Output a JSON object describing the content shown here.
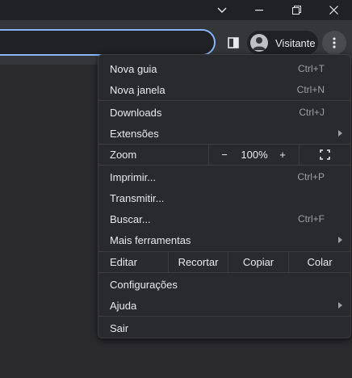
{
  "window": {
    "controls": [
      "chevron-down-icon",
      "minimize-icon",
      "restore-icon",
      "close-icon"
    ]
  },
  "toolbar": {
    "profile_label": "Visitante"
  },
  "menu": {
    "new_tab": {
      "label": "Nova guia",
      "shortcut": "Ctrl+T"
    },
    "new_window": {
      "label": "Nova janela",
      "shortcut": "Ctrl+N"
    },
    "downloads": {
      "label": "Downloads",
      "shortcut": "Ctrl+J"
    },
    "extensions": {
      "label": "Extensões"
    },
    "zoom": {
      "label": "Zoom",
      "minus": "−",
      "value": "100%",
      "plus": "+"
    },
    "print": {
      "label": "Imprimir...",
      "shortcut": "Ctrl+P"
    },
    "cast": {
      "label": "Transmitir..."
    },
    "find": {
      "label": "Buscar...",
      "shortcut": "Ctrl+F"
    },
    "more_tools": {
      "label": "Mais ferramentas"
    },
    "edit": {
      "label": "Editar",
      "cut": "Recortar",
      "copy": "Copiar",
      "paste": "Colar"
    },
    "settings": {
      "label": "Configurações"
    },
    "help": {
      "label": "Ajuda"
    },
    "exit": {
      "label": "Sair"
    }
  },
  "colors": {
    "accent": "#8ab4f8",
    "menu_bg": "#292a2d",
    "text": "#e8eaed",
    "muted": "#9aa0a6"
  }
}
